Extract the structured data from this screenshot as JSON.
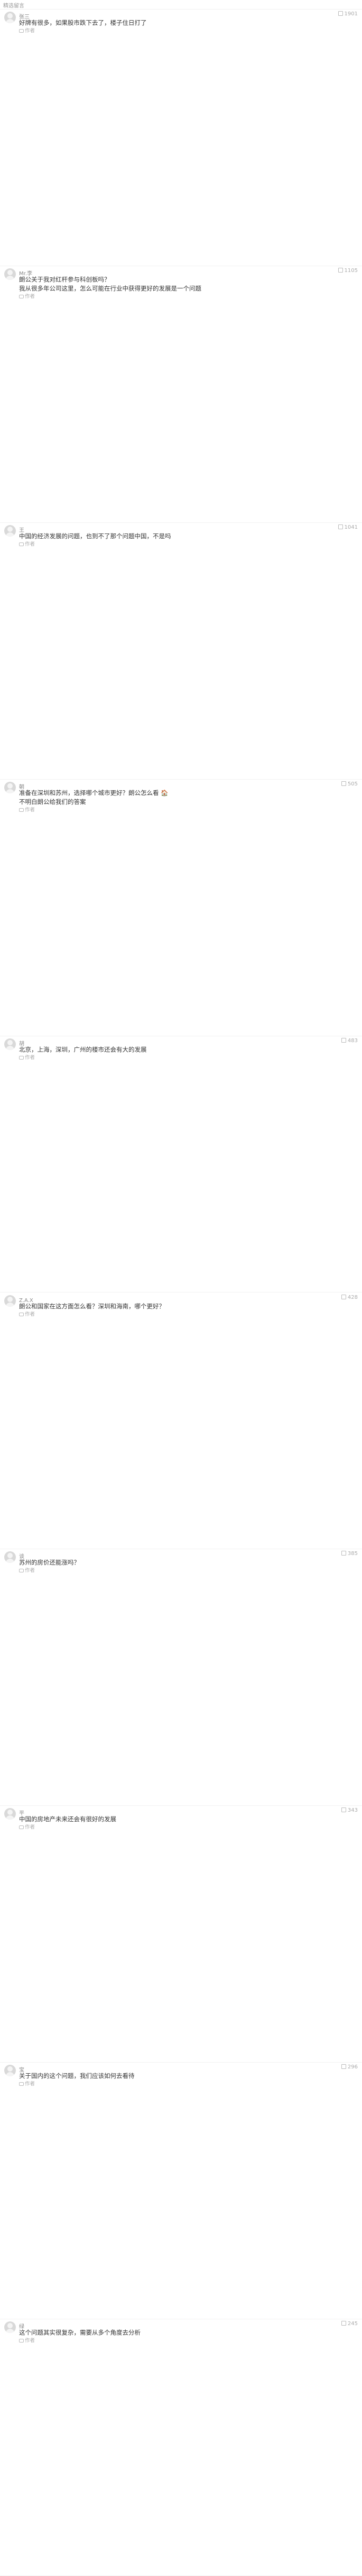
{
  "section_title": "精选留言",
  "reply_label": "作者",
  "comments": [
    {
      "user": "张三",
      "likes": "1901",
      "text": "好牌有很多，如果股市跌下去了，楼子住日打了"
    },
    {
      "user": "Mr.李",
      "likes": "1105",
      "text": "朗公关于我对红杆参与科创板吗？",
      "extra": "我从很多年公司这里，怎么可能在行业中获得更好的发展是一个问题"
    },
    {
      "user": "王",
      "likes": "1041",
      "text": "中国的经济发展的问题，也到不了那个问题中国，不是吗"
    },
    {
      "user": "朝",
      "likes": "505",
      "text": "准备在深圳和苏州，选择哪个城市更好？朗公怎么看 🏠",
      "extra": "不明白朗公给我们的答案"
    },
    {
      "user": "胡",
      "likes": "483",
      "text": "北京，上海，深圳，广州的楼市还会有大的发展"
    },
    {
      "user": "Z.A.X",
      "likes": "428",
      "text": "朗公和国家在这方面怎么看？深圳和海南，哪个更好？"
    },
    {
      "user": "谈",
      "likes": "385",
      "text": "苏州的房价还能涨吗？"
    },
    {
      "user": "平",
      "likes": "343",
      "text": "中国的房地产未来还会有很好的发展"
    },
    {
      "user": "宝",
      "likes": "296",
      "text": "关于国内的这个问题，我们应该如何去看待"
    },
    {
      "user": "绿",
      "likes": "245",
      "text": "这个问题其实很复杂，需要从多个角度去分析"
    }
  ]
}
